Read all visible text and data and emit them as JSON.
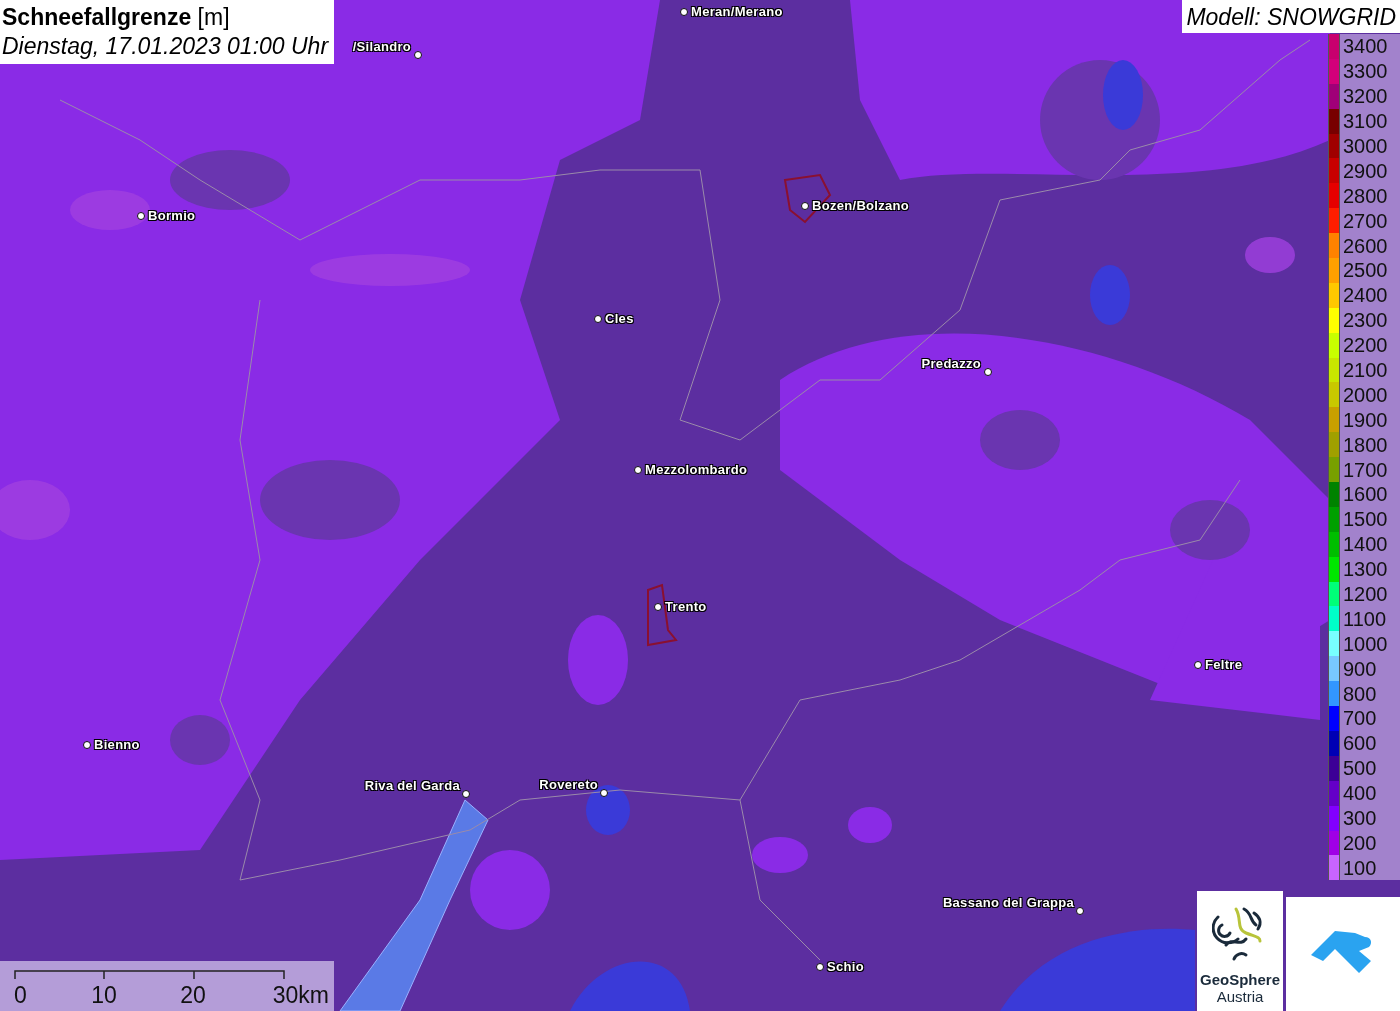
{
  "header": {
    "title": "**Schneefallgrenze** [m]",
    "datetime": "Dienstag, 17.01.2023 01:00 Uhr"
  },
  "model_label": "Modell: SNOWGRID",
  "cities": [
    {
      "name": "Meran/Merano"
    },
    {
      "name": "/Silandro"
    },
    {
      "name": "Bormio"
    },
    {
      "name": "Bozen/Bolzano"
    },
    {
      "name": "Cles"
    },
    {
      "name": "Predazzo"
    },
    {
      "name": "Mezzolombardo"
    },
    {
      "name": "Trento"
    },
    {
      "name": "Feltre"
    },
    {
      "name": "Bienno"
    },
    {
      "name": "Riva del Garda"
    },
    {
      "name": "Rovereto"
    },
    {
      "name": "Bassano del Grappa"
    },
    {
      "name": "Schio"
    }
  ],
  "legend": [
    {
      "value": "3400",
      "color": "#c8006e"
    },
    {
      "value": "3300",
      "color": "#d2007a"
    },
    {
      "value": "3200",
      "color": "#a00078"
    },
    {
      "value": "3100",
      "color": "#780000"
    },
    {
      "value": "3000",
      "color": "#a00000"
    },
    {
      "value": "2900",
      "color": "#c80000"
    },
    {
      "value": "2800",
      "color": "#e60000"
    },
    {
      "value": "2700",
      "color": "#ff1e00"
    },
    {
      "value": "2600",
      "color": "#ff8200"
    },
    {
      "value": "2500",
      "color": "#ffa000"
    },
    {
      "value": "2400",
      "color": "#ffc800"
    },
    {
      "value": "2300",
      "color": "#ffff00"
    },
    {
      "value": "2200",
      "color": "#c8ff00"
    },
    {
      "value": "2100",
      "color": "#c8e600"
    },
    {
      "value": "2000",
      "color": "#c8c800"
    },
    {
      "value": "1900",
      "color": "#c8a000"
    },
    {
      "value": "1800",
      "color": "#a0a000"
    },
    {
      "value": "1700",
      "color": "#78a000"
    },
    {
      "value": "1600",
      "color": "#008200"
    },
    {
      "value": "1500",
      "color": "#00a000"
    },
    {
      "value": "1400",
      "color": "#00be00"
    },
    {
      "value": "1300",
      "color": "#00e600"
    },
    {
      "value": "1200",
      "color": "#00ff78"
    },
    {
      "value": "1100",
      "color": "#00ffc8"
    },
    {
      "value": "1000",
      "color": "#78ffff"
    },
    {
      "value": "900",
      "color": "#78c8ff"
    },
    {
      "value": "800",
      "color": "#3296ff"
    },
    {
      "value": "700",
      "color": "#0000ff"
    },
    {
      "value": "600",
      "color": "#0000b4"
    },
    {
      "value": "500",
      "color": "#3c0096"
    },
    {
      "value": "400",
      "color": "#6400c8"
    },
    {
      "value": "300",
      "color": "#8200ff"
    },
    {
      "value": "200",
      "color": "#a000e6"
    },
    {
      "value": "100",
      "color": "#c864ff"
    }
  ],
  "scale_bar": {
    "labels": [
      "0",
      "10",
      "20",
      "30km"
    ]
  },
  "logo": {
    "name": "GeoSphere",
    "subtitle": "Austria"
  }
}
